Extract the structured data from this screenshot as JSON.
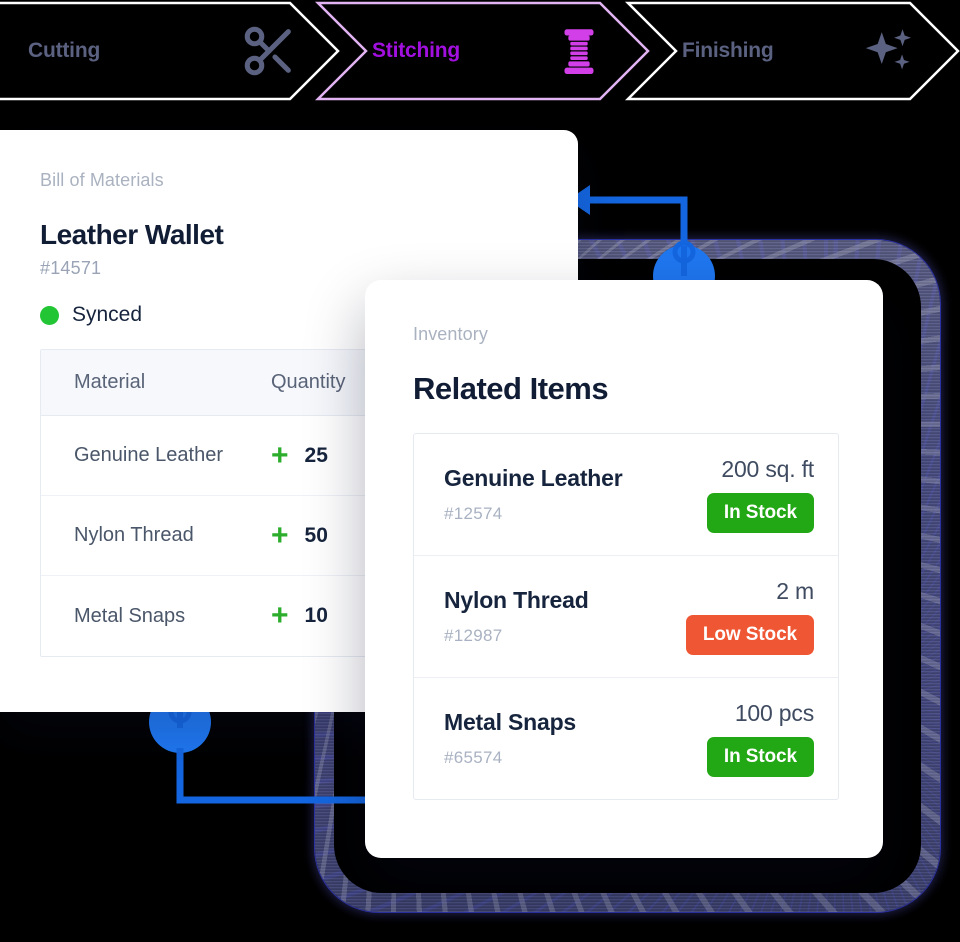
{
  "pipeline": {
    "steps": [
      {
        "label": "Cutting",
        "icon": "scissors-icon",
        "state": "inactive",
        "color": "#5b6180"
      },
      {
        "label": "Stitching",
        "icon": "thread-spool-icon",
        "state": "active",
        "color": "#a210e0"
      },
      {
        "label": "Finishing",
        "icon": "sparkles-icon",
        "state": "inactive",
        "color": "#5b6180"
      }
    ]
  },
  "bom_card": {
    "eyebrow": "Bill of Materials",
    "title": "Leather Wallet",
    "reference": "#14571",
    "status": {
      "label": "Synced",
      "dot_color": "#22c534"
    },
    "table": {
      "columns": [
        "Material",
        "Quantity"
      ],
      "rows": [
        {
          "material": "Genuine Leather",
          "quantity": "25",
          "adjust_icon": "plus-icon"
        },
        {
          "material": "Nylon Thread",
          "quantity": "50",
          "adjust_icon": "plus-icon"
        },
        {
          "material": "Metal Snaps",
          "quantity": "10",
          "adjust_icon": "plus-icon"
        }
      ]
    }
  },
  "inventory_card": {
    "eyebrow": "Inventory",
    "title": "Related Items",
    "items": [
      {
        "name": "Genuine Leather",
        "id": "#12574",
        "quantity": "200 sq. ft",
        "badge": "In Stock",
        "badge_color": "#22a814"
      },
      {
        "name": "Nylon Thread",
        "id": "#12987",
        "quantity": "2 m",
        "badge": "Low Stock",
        "badge_color": "#ef5734"
      },
      {
        "name": "Metal Snaps",
        "id": "#65574",
        "quantity": "100 pcs",
        "badge": "In Stock",
        "badge_color": "#22a814"
      }
    ]
  },
  "decorations": {
    "connector_color": "#1466e0",
    "backdrop_edge_color": "#4a4f86"
  }
}
